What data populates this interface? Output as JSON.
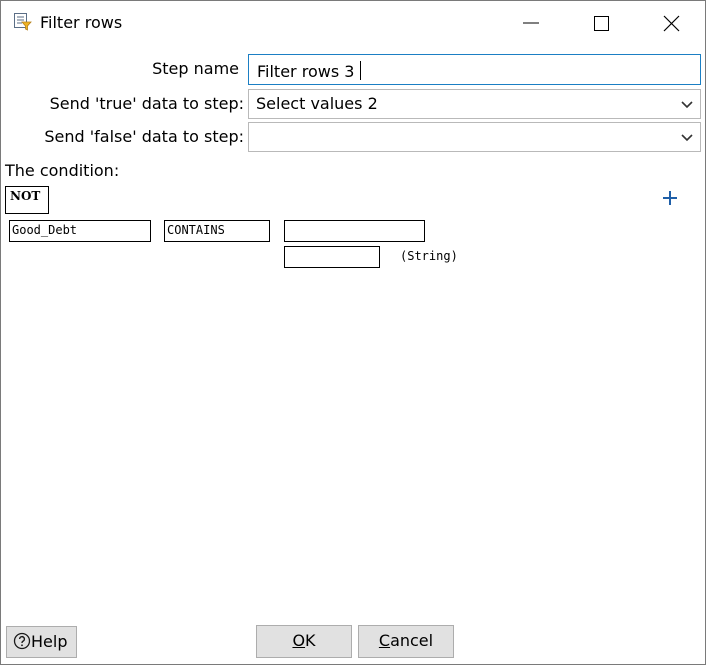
{
  "window": {
    "title": "Filter rows",
    "app_icon": "filter-rows-step-icon",
    "controls": [
      "minimize-icon",
      "maximize-icon",
      "close-icon"
    ]
  },
  "form": {
    "step_name_label": "Step name",
    "step_name_value": "Filter rows 3",
    "true_label": "Send 'true' data to step:",
    "true_value": "Select values 2",
    "false_label": "Send 'false' data to step:",
    "false_value": ""
  },
  "condition": {
    "label": "The condition:",
    "negate": "NOT",
    "field": "Good_Debt",
    "function": "CONTAINS",
    "value": "",
    "exact_value": "",
    "type": "(String)",
    "add_icon": "plus-icon"
  },
  "buttons": {
    "help_label": "Help",
    "help_icon": "help-circle-icon",
    "ok_mnemonic": "O",
    "ok_rest": "K",
    "cancel_mnemonic": "C",
    "cancel_rest": "ancel"
  },
  "colors": {
    "focus_border": "#1b7fc4",
    "plus": "#1f5fa8",
    "button_bg": "#e1e1e1"
  }
}
